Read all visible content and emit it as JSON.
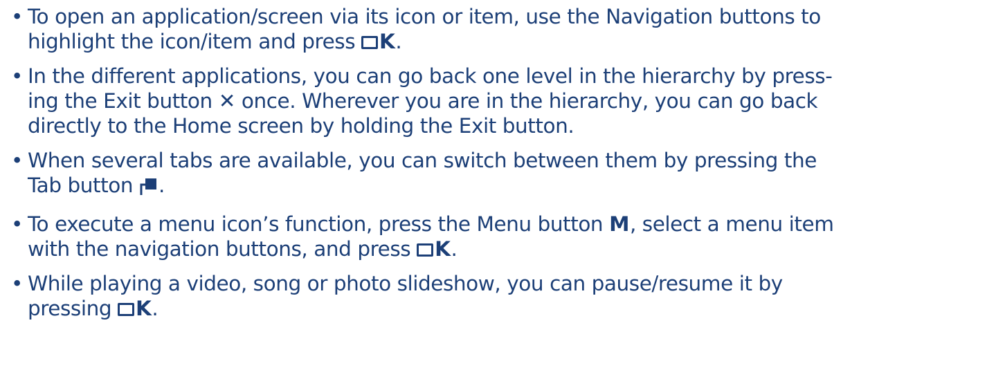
{
  "bullet_symbol": "•",
  "keys": {
    "ok_letter": "K",
    "exit_symbol": "✕",
    "menu_letter": "M"
  },
  "items": [
    {
      "t1": "To open an application/screen via its icon or item, use the Navigation buttons to",
      "t2": "highlight the icon/item and press ",
      "t3": "."
    },
    {
      "t1": "In the different applications, you can go back one level in the hierarchy by press-",
      "t2": "ing the Exit button ",
      "t3": " once. Wherever you are in the hierarchy, you can go back",
      "t4": "directly to the Home screen by holding the Exit button."
    },
    {
      "t1": "When several tabs are available, you can switch between them by pressing the",
      "t2": "Tab button ",
      "t3": "."
    },
    {
      "t1": "To execute a menu icon’s function, press the Menu button ",
      "t2": ", select a menu item",
      "t3": "with the navigation buttons, and press ",
      "t4": "."
    },
    {
      "t1": "While playing a video, song or photo slideshow, you can pause/resume it by",
      "t2": "pressing ",
      "t3": "."
    }
  ]
}
